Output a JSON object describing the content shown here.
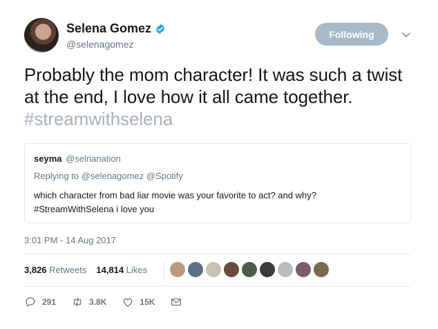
{
  "user": {
    "display_name": "Selena Gomez",
    "handle": "@selenagomez",
    "follow_label": "Following",
    "verified_color": "#1da1f2"
  },
  "tweet": {
    "text": "Probably the mom character! It was such a twist at the end, I love how it all came together.",
    "hashtag": "#streamwithselena",
    "timestamp": "3:01 PM - 14 Aug 2017"
  },
  "quoted": {
    "name": "seyma",
    "handle": "@selrianation",
    "replying": "Replying to @selenagomez @Spotify",
    "line1": "which character from bad liar movie was your favorite to act? and why?",
    "line2": "#StreamWithSelena i love you"
  },
  "stats": {
    "retweets_count": "3,826",
    "retweets_label": "Retweets",
    "likes_count": "14,814",
    "likes_label": "Likes"
  },
  "liker_colors": [
    "#b89a83",
    "#5b6f86",
    "#c7c2b6",
    "#6a4b3c",
    "#4d5a4a",
    "#3b3b3b",
    "#b7bcc1",
    "#7e5a6a",
    "#7a6a4e"
  ],
  "actions": {
    "replies": "291",
    "retweets": "3.8K",
    "likes": "15K"
  }
}
